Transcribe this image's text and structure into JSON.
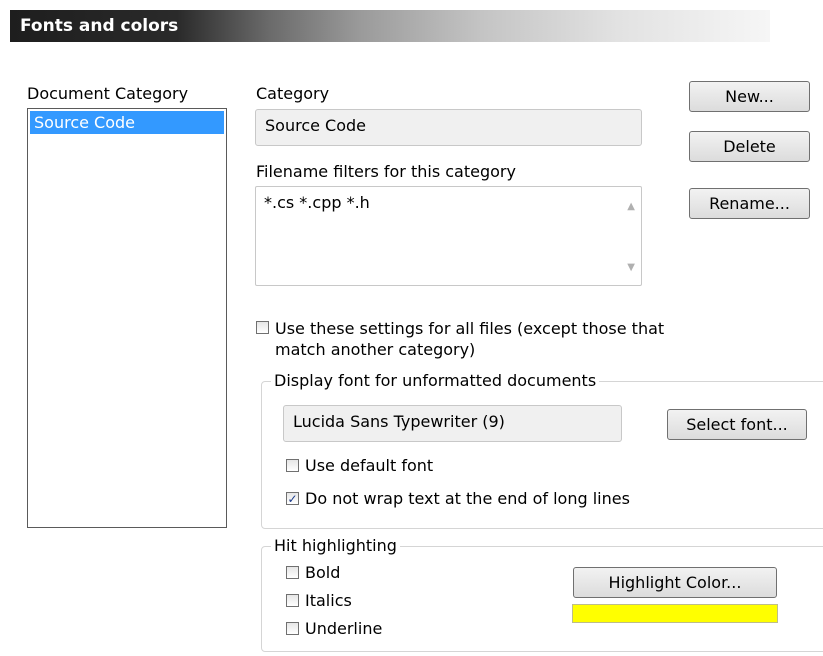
{
  "header": {
    "title": "Fonts and colors"
  },
  "document_category": {
    "label": "Document Category",
    "items": [
      "Source Code"
    ],
    "selected": "Source Code"
  },
  "category": {
    "label": "Category",
    "value": "Source Code"
  },
  "filename_filters": {
    "label": "Filename filters for this category",
    "value": "*.cs *.cpp *.h"
  },
  "buttons": {
    "new": "New...",
    "delete": "Delete",
    "rename": "Rename...",
    "select_font": "Select font...",
    "highlight_color": "Highlight Color..."
  },
  "use_settings_all": {
    "label_line1": "Use these settings for all files (except those that",
    "label_line2": "match another category)",
    "checked": false
  },
  "display_font": {
    "legend": "Display font for unformatted documents",
    "font_value": "Lucida Sans Typewriter (9)",
    "use_default_label": "Use default font",
    "use_default_checked": false,
    "no_wrap_label": "Do not wrap text at the end of long lines",
    "no_wrap_checked": true
  },
  "hit_highlighting": {
    "legend": "Hit highlighting",
    "bold_label": "Bold",
    "bold_checked": false,
    "italics_label": "Italics",
    "italics_checked": false,
    "underline_label": "Underline",
    "underline_checked": false,
    "highlight_color": "#ffff00"
  }
}
